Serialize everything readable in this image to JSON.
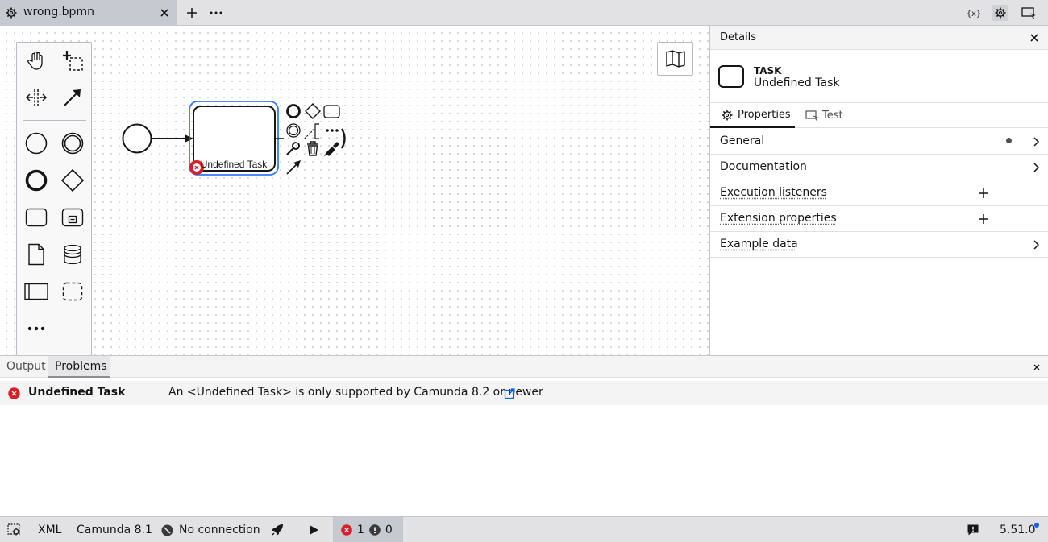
{
  "tab": {
    "name": "wrong.bpmn",
    "icon": "gear-icon"
  },
  "panel": {
    "title": "Details",
    "element_type": "TASK",
    "element_name": "Undefined Task",
    "tabs": [
      "Properties",
      "Test"
    ],
    "groups": [
      {
        "label": "General",
        "action": "chevron",
        "indicator": true
      },
      {
        "label": "Documentation",
        "action": "chevron"
      },
      {
        "label": "Execution listeners",
        "action": "plus"
      },
      {
        "label": "Extension properties",
        "action": "plus"
      },
      {
        "label": "Example data",
        "action": "chevron"
      }
    ]
  },
  "diagram": {
    "task_label": "Undefined Task"
  },
  "bottom": {
    "tabs": [
      "Output",
      "Problems"
    ],
    "active_tab": "Problems",
    "problems": [
      {
        "severity": "error",
        "element": "Undefined Task",
        "message": "An <Undefined Task> is only supported by Camunda 8.2 or newer"
      }
    ]
  },
  "status": {
    "xml": "XML",
    "engine": "Camunda 8.1",
    "connection": "No connection",
    "errors": "1",
    "warnings": "0",
    "version": "5.51.0"
  },
  "colors": {
    "error": "#da1e28",
    "selection": "#0f62fe",
    "accent": "#0f62fe"
  }
}
